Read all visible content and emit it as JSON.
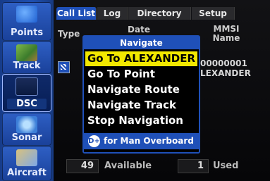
{
  "sidebar": {
    "items": [
      {
        "label": "Points",
        "icon": "points-icon"
      },
      {
        "label": "Track",
        "icon": "track-icon"
      },
      {
        "label": "DSC",
        "icon": "dsc-icon"
      },
      {
        "label": "Sonar",
        "icon": "sonar-icon"
      },
      {
        "label": "Aircraft",
        "icon": "aircraft-icon"
      }
    ],
    "selected": "DSC"
  },
  "tabs": [
    {
      "label": "Call List"
    },
    {
      "label": "Log"
    },
    {
      "label": "Directory"
    },
    {
      "label": "Setup"
    }
  ],
  "table": {
    "headers": {
      "type": "Type",
      "date": "Date",
      "mmsi_line1": "MMSI",
      "mmsi_line2": "Name"
    },
    "rows": [
      {
        "mmsi": "00000001",
        "name": "LEXANDER",
        "icon": "dsc-call-icon"
      }
    ]
  },
  "footer": {
    "available_count": "49",
    "available_label": "Available",
    "used_count": "1",
    "used_label": "Used"
  },
  "popup": {
    "title": "Navigate",
    "items": [
      {
        "label": "Go To ALEXANDER"
      },
      {
        "label": "Go To Point"
      },
      {
        "label": "Navigate Route"
      },
      {
        "label": "Navigate Track"
      },
      {
        "label": "Stop Navigation"
      }
    ],
    "selected_index": 0,
    "footer_key": "D+",
    "footer_text": "for Man Overboard"
  },
  "colors": {
    "accent": "#1f50b8",
    "highlight": "#f2e800",
    "background": "#000000"
  }
}
